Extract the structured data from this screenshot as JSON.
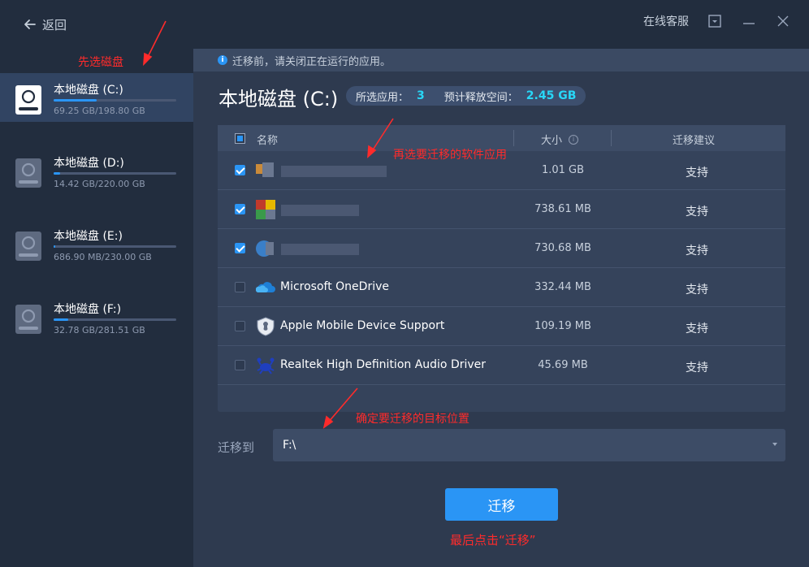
{
  "titlebar": {
    "back_label": "返回",
    "support_label": "在线客服"
  },
  "annotations": {
    "select_disk": "先选磁盘",
    "select_apps": "再选要迁移的软件应用",
    "select_target": "确定要迁移的目标位置",
    "click_migrate": "最后点击“迁移”"
  },
  "sidebar": {
    "disks": [
      {
        "name": "本地磁盘 (C:)",
        "size": "69.25 GB/198.80 GB",
        "usage": 0.35,
        "active": true
      },
      {
        "name": "本地磁盘 (D:)",
        "size": "14.42 GB/220.00 GB",
        "usage": 0.05,
        "active": false
      },
      {
        "name": "本地磁盘 (E:)",
        "size": "686.90 MB/230.00 GB",
        "usage": 0.01,
        "active": false
      },
      {
        "name": "本地磁盘 (F:)",
        "size": "32.78 GB/281.51 GB",
        "usage": 0.12,
        "active": false
      }
    ]
  },
  "main": {
    "notice": "迁移前，请关闭正在运行的应用。",
    "disk_title": "本地磁盘 (C:)",
    "summary": {
      "selected_label": "所选应用：",
      "selected_count": "3",
      "free_label": "预计释放空间：",
      "free_value": "2.45 GB"
    },
    "table": {
      "headers": {
        "name": "名称",
        "size": "大小",
        "advice": "迁移建议"
      },
      "rows": [
        {
          "name": "",
          "size": "1.01 GB",
          "advice": "支持",
          "checked": true
        },
        {
          "name": "",
          "size": "738.61 MB",
          "advice": "支持",
          "checked": true
        },
        {
          "name": "",
          "size": "730.68 MB",
          "advice": "支持",
          "checked": true
        },
        {
          "name": "Microsoft OneDrive",
          "size": "332.44 MB",
          "advice": "支持",
          "checked": false
        },
        {
          "name": "Apple Mobile Device Support",
          "size": "109.19 MB",
          "advice": "支持",
          "checked": false
        },
        {
          "name": "Realtek High Definition Audio Driver",
          "size": "45.69 MB",
          "advice": "支持",
          "checked": false
        }
      ]
    },
    "target": {
      "label": "迁移到",
      "value": "F:\\"
    },
    "migrate_button": "迁移"
  },
  "colors": {
    "accent": "#2a95f5",
    "highlight": "#28d7f7",
    "annotation": "#ff2b2b"
  }
}
